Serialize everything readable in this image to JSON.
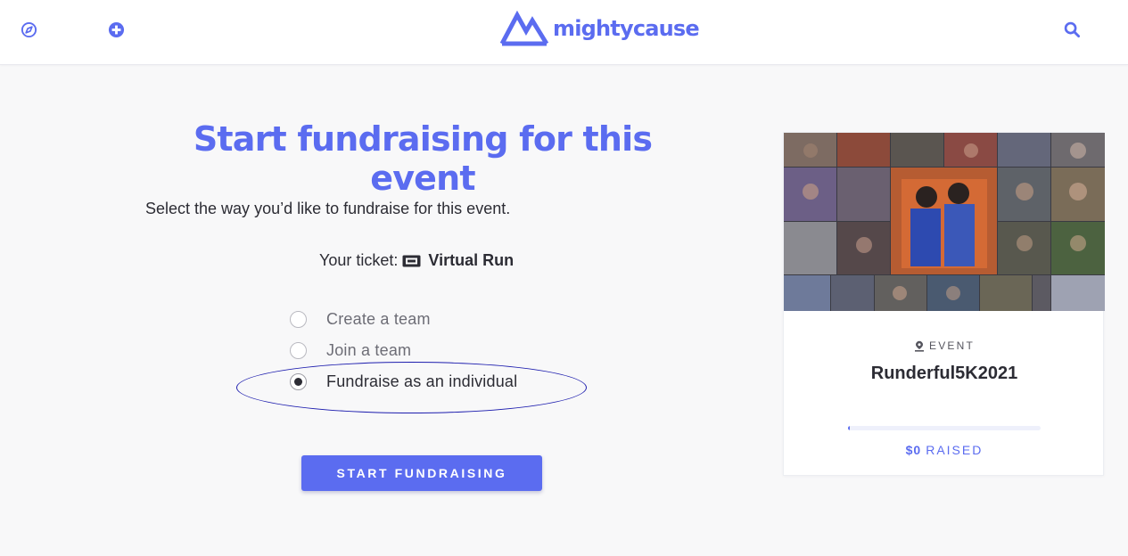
{
  "header": {
    "brand": "mightycause",
    "icons": [
      "compass-icon",
      "plus-circle-icon",
      "search-icon"
    ],
    "accent_color": "#5b6cf0"
  },
  "main": {
    "title": "Start fundraising for this event",
    "subtitle": "Select the way you’d like to fundraise for this event.",
    "ticket_label": "Your ticket:",
    "ticket_name": "Virtual Run",
    "options": [
      {
        "label": "Create a team",
        "selected": false
      },
      {
        "label": "Join a team",
        "selected": false
      },
      {
        "label": "Fundraise as an individual",
        "selected": true
      }
    ],
    "start_button": "START FUNDRAISING"
  },
  "event_card": {
    "tag": "EVENT",
    "name": "Runderful5K2021",
    "raised_amount": "$0",
    "raised_label": "RAISED",
    "progress_fraction": 0.01
  }
}
